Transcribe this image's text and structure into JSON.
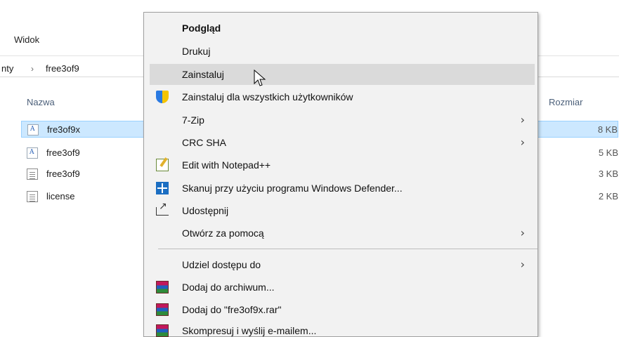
{
  "ribbon": {
    "view_tab": "Widok"
  },
  "address": {
    "crumbs": [
      "nty",
      "free3of9"
    ],
    "separator": "›"
  },
  "columns": {
    "name": "Nazwa",
    "size": "Rozmiar"
  },
  "files": [
    {
      "name": "fre3of9x",
      "size": "8 KB",
      "icon": "font-file-icon",
      "selected": true
    },
    {
      "name": "free3of9",
      "size": "5 KB",
      "icon": "font-file-icon",
      "selected": false
    },
    {
      "name": "free3of9",
      "size": "3 KB",
      "icon": "text-file-icon",
      "selected": false
    },
    {
      "name": "license",
      "size": "2 KB",
      "icon": "text-file-icon",
      "selected": false
    }
  ],
  "context_menu": {
    "items": [
      {
        "label": "Podgląd",
        "bold": true
      },
      {
        "label": "Drukuj"
      },
      {
        "label": "Zainstaluj",
        "hover": true
      },
      {
        "label": "Zainstaluj dla wszystkich użytkowników",
        "icon": "shield-icon"
      },
      {
        "label": "7-Zip",
        "submenu": true
      },
      {
        "label": "CRC SHA",
        "submenu": true
      },
      {
        "label": "Edit with Notepad++",
        "icon": "notepad-icon"
      },
      {
        "label": "Skanuj przy użyciu programu Windows Defender...",
        "icon": "windows-defender-icon"
      },
      {
        "label": "Udostępnij",
        "icon": "share-icon"
      },
      {
        "label": "Otwórz za pomocą",
        "submenu": true
      },
      {
        "label": "Udziel dostępu do",
        "submenu": true
      },
      {
        "label": "Dodaj do archiwum...",
        "icon": "winrar-icon"
      },
      {
        "label": "Dodaj do \"fre3of9x.rar\"",
        "icon": "winrar-icon"
      },
      {
        "label": "Skompresuj i wyślij e-mailem...",
        "icon": "winrar-icon"
      }
    ],
    "submenu_arrow": "›"
  },
  "colors": {
    "selection": "#cce8ff",
    "menu_bg": "#f2f2f2",
    "menu_hover": "#dadada"
  }
}
